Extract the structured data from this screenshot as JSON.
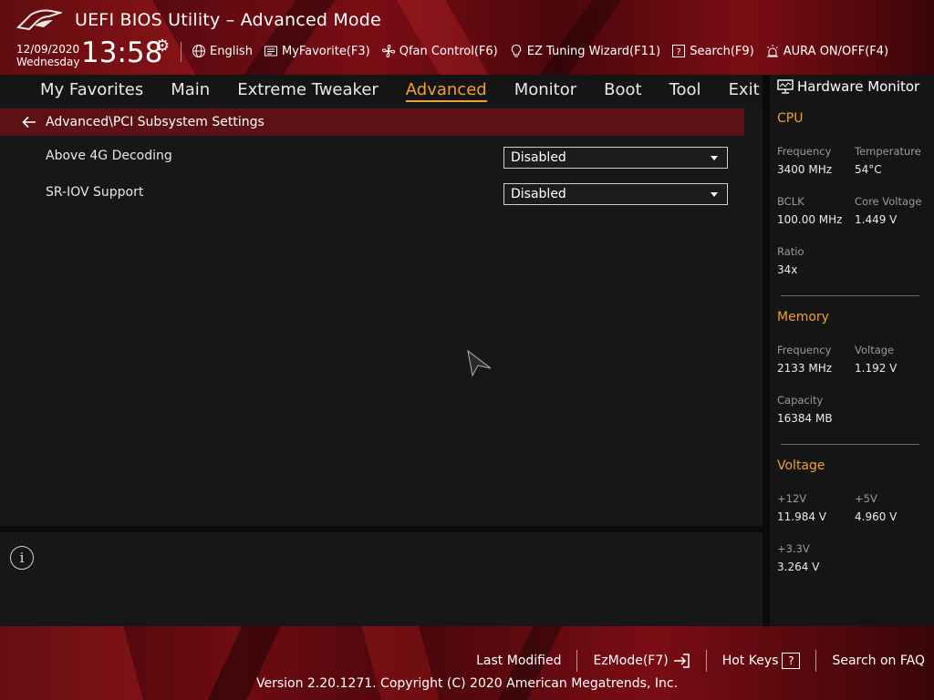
{
  "header": {
    "title": "UEFI BIOS Utility – Advanced Mode",
    "date": "12/09/2020",
    "weekday": "Wednesday",
    "time": "13:58",
    "toolbar": {
      "language": "English",
      "my_favorite": "MyFavorite(F3)",
      "qfan": "Qfan Control(F6)",
      "ez_tuning": "EZ Tuning Wizard(F11)",
      "search": "Search(F9)",
      "aura": "AURA ON/OFF(F4)"
    }
  },
  "tabs": [
    {
      "label": "My Favorites",
      "active": false
    },
    {
      "label": "Main",
      "active": false
    },
    {
      "label": "Extreme Tweaker",
      "active": false
    },
    {
      "label": "Advanced",
      "active": true
    },
    {
      "label": "Monitor",
      "active": false
    },
    {
      "label": "Boot",
      "active": false
    },
    {
      "label": "Tool",
      "active": false
    },
    {
      "label": "Exit",
      "active": false
    }
  ],
  "breadcrumb": "Advanced\\PCI Subsystem Settings",
  "settings": [
    {
      "label": "Above 4G Decoding",
      "value": "Disabled"
    },
    {
      "label": "SR-IOV Support",
      "value": "Disabled"
    }
  ],
  "hardware_monitor": {
    "title": "Hardware Monitor",
    "cpu": {
      "heading": "CPU",
      "frequency_label": "Frequency",
      "frequency": "3400 MHz",
      "temperature_label": "Temperature",
      "temperature": "54°C",
      "bclk_label": "BCLK",
      "bclk": "100.00 MHz",
      "core_voltage_label": "Core Voltage",
      "core_voltage": "1.449 V",
      "ratio_label": "Ratio",
      "ratio": "34x"
    },
    "memory": {
      "heading": "Memory",
      "frequency_label": "Frequency",
      "frequency": "2133 MHz",
      "voltage_label": "Voltage",
      "voltage": "1.192 V",
      "capacity_label": "Capacity",
      "capacity": "16384 MB"
    },
    "voltage": {
      "heading": "Voltage",
      "v12_label": "+12V",
      "v12": "11.984 V",
      "v5_label": "+5V",
      "v5": "4.960 V",
      "v33_label": "+3.3V",
      "v33": "3.264 V"
    }
  },
  "footer": {
    "last_modified": "Last Modified",
    "ezmode": "EzMode(F7)",
    "hot_keys": "Hot Keys",
    "hot_keys_box": "?",
    "search_faq": "Search on FAQ",
    "copyright": "Version 2.20.1271. Copyright (C) 2020 American Megatrends, Inc."
  },
  "colors": {
    "accent": "#f0a030",
    "breadcrumb_bg": "#5c1115",
    "panel_bg": "#171717"
  },
  "icons": {
    "info": "i",
    "settings": "⚙"
  }
}
